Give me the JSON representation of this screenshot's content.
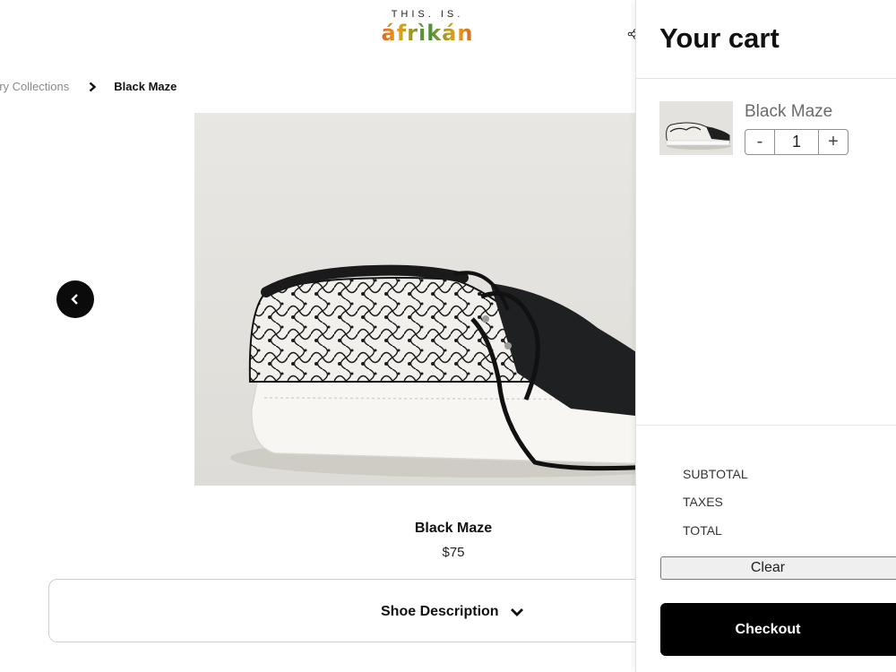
{
  "header": {
    "brand_top": "THIS. IS.",
    "brand_logo": "áfrìkán",
    "share_icon": "share-icon"
  },
  "breadcrumb": {
    "parent": "ury Collections",
    "current": "Black Maze"
  },
  "gallery": {
    "prev_icon": "chevron-left-icon"
  },
  "product": {
    "name": "Black Maze",
    "price": "$75",
    "description_toggle": "Shoe Description"
  },
  "cart": {
    "title": "Your cart",
    "items": [
      {
        "name": "Black Maze",
        "quantity": "1",
        "minus": "-",
        "plus": "+"
      }
    ],
    "summary": {
      "subtotal_label": "SUBTOTAL",
      "taxes_label": "TAXES",
      "total_label": "TOTAL"
    },
    "clear_label": "Clear",
    "checkout_label": "Checkout"
  },
  "colors": {
    "accent": "#000000",
    "muted_text": "#8a8a8a",
    "border": "#cfcfcf"
  }
}
